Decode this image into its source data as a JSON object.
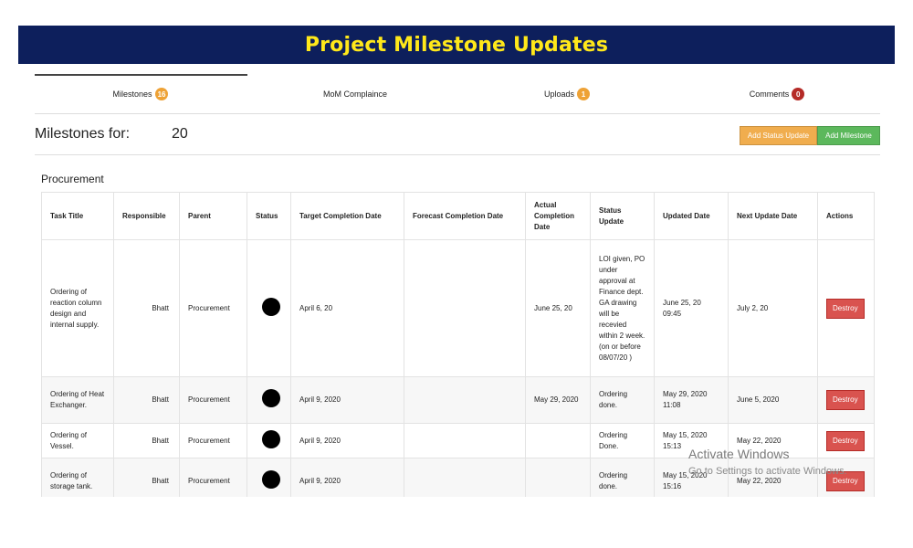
{
  "banner": {
    "title": "Project Milestone Updates"
  },
  "tabs": [
    {
      "label": "Milestones",
      "count": "16",
      "color": "#eea236"
    },
    {
      "label": "MoM Complaince",
      "count": ""
    },
    {
      "label": "Uploads",
      "count": "1",
      "color": "#eea236"
    },
    {
      "label": "Comments",
      "count": "0",
      "color": "#b52b27"
    }
  ],
  "header": {
    "milestones_for_label": "Milestones for:",
    "milestones_for_value": "20",
    "add_status_update_label": "Add Status Update",
    "add_milestone_label": "Add Milestone"
  },
  "section": {
    "title": "Procurement"
  },
  "table": {
    "columns": [
      "Task Title",
      "Responsible",
      "Parent",
      "Status",
      "Target Completion Date",
      "Forecast Completion Date",
      "Actual Completion Date",
      "Status Update",
      "Updated Date",
      "Next Update Date",
      "Actions"
    ],
    "rows": [
      {
        "task_title": "Ordering of reaction column design and internal supply.",
        "responsible": "Bhatt",
        "parent": "Procurement",
        "target": "April 6, 20",
        "forecast": "",
        "actual": "June 25, 20",
        "status_update": "LOI given, PO under approval at Finance dept. GA drawing will be recevied within 2 week. (on or before 08/07/20 )",
        "updated": "June 25, 20 09:45",
        "next_update": "July 2, 20",
        "action": "Destroy"
      },
      {
        "task_title": "Ordering of Heat Exchanger.",
        "responsible": "Bhatt",
        "parent": "Procurement",
        "target": "April 9, 2020",
        "forecast": "",
        "actual": "May 29, 2020",
        "status_update": "Ordering done.",
        "updated": "May 29, 2020 11:08",
        "next_update": "June 5, 2020",
        "action": "Destroy"
      },
      {
        "task_title": "Ordering of Vessel.",
        "responsible": "Bhatt",
        "parent": "Procurement",
        "target": "April 9, 2020",
        "forecast": "",
        "actual": "",
        "status_update": "Ordering Done.",
        "updated": "May 15, 2020 15:13",
        "next_update": "May 22, 2020",
        "action": "Destroy"
      },
      {
        "task_title": "Ordering of storage tank.",
        "responsible": "Bhatt",
        "parent": "Procurement",
        "target": "April 9, 2020",
        "forecast": "",
        "actual": "",
        "status_update": "Ordering done.",
        "updated": "May 15, 2020 15:16",
        "next_update": "May 22, 2020",
        "action": "Destroy"
      }
    ]
  },
  "watermark": {
    "title": "Activate Windows",
    "subtitle": "Go to Settings to activate Windows."
  }
}
